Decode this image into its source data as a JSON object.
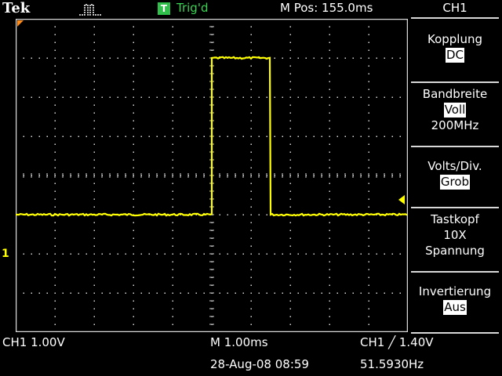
{
  "header": {
    "brand": "Tek",
    "trigger_badge": "T",
    "trigger_status": "Trig'd",
    "m_pos": "M Pos: 155.0ms",
    "channel": "CH1"
  },
  "side_menu": [
    {
      "label": "Kopplung",
      "value": "DC"
    },
    {
      "label": "Bandbreite",
      "value": "Voll",
      "extra": "200MHz"
    },
    {
      "label": "Volts/Div.",
      "value": "Grob"
    },
    {
      "label": "Tastkopf",
      "line2": "10X",
      "line3": "Spannung"
    },
    {
      "label": "Invertierung",
      "value": "Aus"
    }
  ],
  "screen": {
    "channel_marker": "1",
    "grid": {
      "divisions_x": 10,
      "divisions_y": 8
    },
    "trace_color": "#ffff00",
    "waveform": {
      "type": "pulse",
      "x_range": [
        0,
        10
      ],
      "y_range": [
        -4,
        4
      ],
      "baseline_level": -1.0,
      "high_level": 3.0,
      "rise_division": 5.0,
      "fall_division": 6.5
    }
  },
  "footer": {
    "scale": "CH1  1.00V",
    "timebase": "M 1.00ms",
    "trigger": "CH1 ╱ 1.40V",
    "date": "28-Aug-08 08:59",
    "frequency": "51.5930Hz"
  },
  "colors": {
    "trigger_green": "#39d353",
    "trace": "#ffff00",
    "grid": "#d8d8d8"
  }
}
